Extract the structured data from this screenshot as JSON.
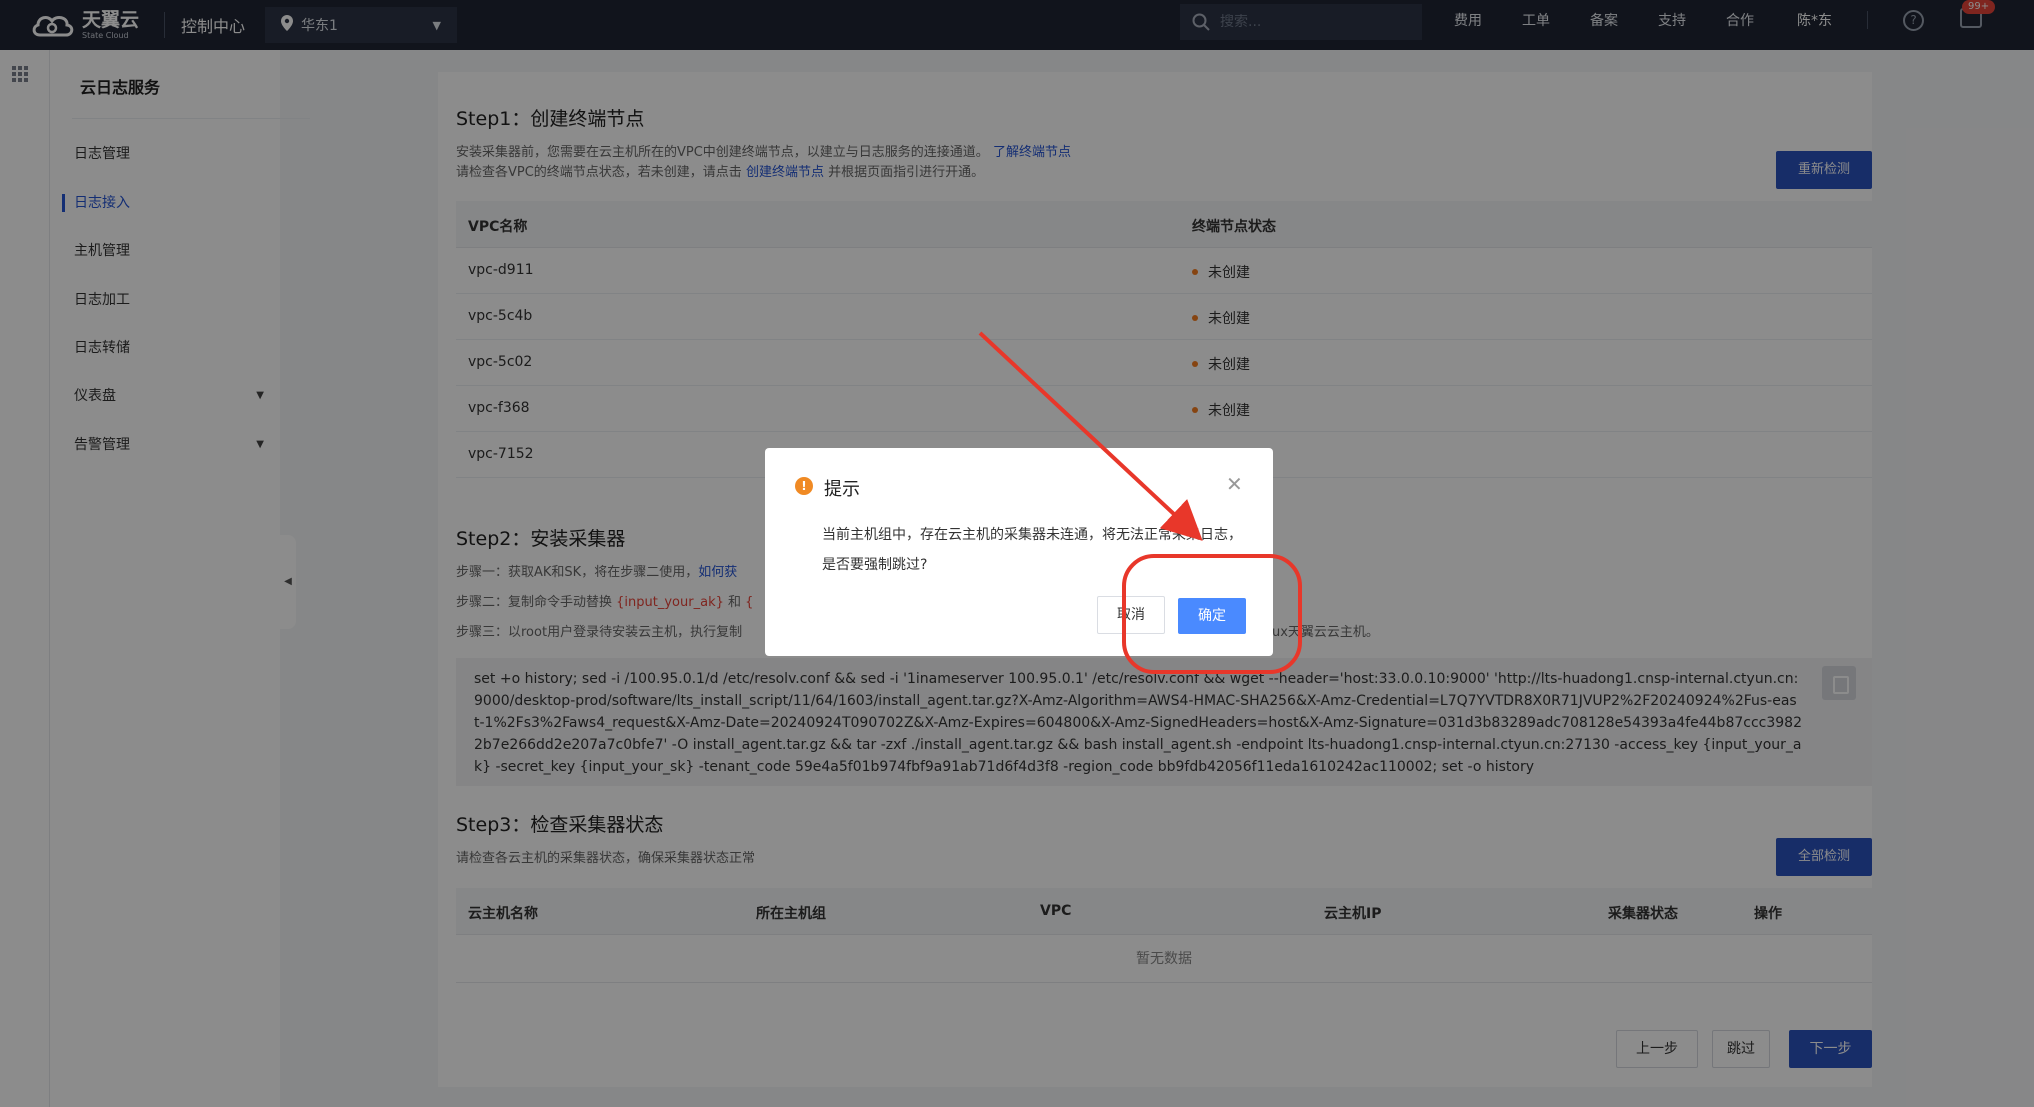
{
  "topbar": {
    "logo_cn": "天翼云",
    "logo_en": "State Cloud",
    "console": "控制中心",
    "region": "华东1",
    "search_placeholder": "搜索...",
    "nav": [
      "费用",
      "工单",
      "备案",
      "支持",
      "合作"
    ],
    "user": "陈*东",
    "badge": "99+"
  },
  "sidebar": {
    "title": "云日志服务",
    "items": [
      {
        "label": "日志管理"
      },
      {
        "label": "日志接入"
      },
      {
        "label": "主机管理"
      },
      {
        "label": "日志加工"
      },
      {
        "label": "日志转储"
      },
      {
        "label": "仪表盘"
      },
      {
        "label": "告警管理"
      }
    ]
  },
  "step1": {
    "title": "Step1：创建终端节点",
    "desc1": "安装采集器前，您需要在云主机所在的VPC中创建终端节点，以建立与日志服务的连接通道。",
    "desc1_link": "了解终端节点",
    "desc2_a": "请检查各VPC的终端节点状态，若未创建，请点击",
    "desc2_link": "创建终端节点",
    "desc2_b": "并根据页面指引进行开通。",
    "recheck": "重新检测",
    "col_vpc": "VPC名称",
    "col_status": "终端节点状态",
    "rows": [
      {
        "name": "vpc-d911",
        "status": "未创建"
      },
      {
        "name": "vpc-5c4b",
        "status": "未创建"
      },
      {
        "name": "vpc-5c02",
        "status": "未创建"
      },
      {
        "name": "vpc-f368",
        "status": "未创建"
      },
      {
        "name": "vpc-7152",
        "status": ""
      }
    ]
  },
  "step2": {
    "title": "Step2：安装采集器",
    "line1": "步骤一：获取AK和SK，将在步骤二使用，",
    "line1_link": "如何获",
    "line2_a": "步骤二：复制命令手动替换",
    "line2_red": "{input_your_ak}",
    "line2_b": "和",
    "line2_red2": "{",
    "line3": "步骤三：以root用户登录待安装云主机，执行复制",
    "line3_tail": "ux天翼云云主机。",
    "command": "set +o history; sed -i /100.95.0.1/d /etc/resolv.conf && sed -i '1inameserver 100.95.0.1' /etc/resolv.conf && wget --header='host:33.0.0.10:9000' 'http://lts-huadong1.cnsp-internal.ctyun.cn:9000/desktop-prod/software/lts_install_script/11/64/1603/install_agent.tar.gz?X-Amz-Algorithm=AWS4-HMAC-SHA256&X-Amz-Credential=L7Q7YVTDR8X0R71JVUP2%2F20240924%2Fus-east-1%2Fs3%2Faws4_request&X-Amz-Date=20240924T090702Z&X-Amz-Expires=604800&X-Amz-SignedHeaders=host&X-Amz-Signature=031d3b83289adc708128e54393a4fe44b87ccc39822b7e266dd2e207a7c0bfe7' -O install_agent.tar.gz && tar -zxf ./install_agent.tar.gz && bash install_agent.sh -endpoint lts-huadong1.cnsp-internal.ctyun.cn:27130 -access_key {input_your_ak} -secret_key {input_your_sk} -tenant_code 59e4a5f01b974fbf9a91ab71d6f4d3f8 -region_code bb9fdb42056f11eda1610242ac110002; set -o history"
  },
  "step3": {
    "title": "Step3：检查采集器状态",
    "desc": "请检查各云主机的采集器状态，确保采集器状态正常",
    "check_all": "全部检测",
    "cols": [
      "云主机名称",
      "所在主机组",
      "VPC",
      "云主机IP",
      "采集器状态",
      "操作"
    ],
    "empty": "暂无数据"
  },
  "footer": {
    "prev": "上一步",
    "skip": "跳过",
    "next": "下一步"
  },
  "modal": {
    "title": "提示",
    "body": "当前主机组中，存在云主机的采集器未连通，将无法正常采集日志，是否要强制跳过?",
    "cancel": "取消",
    "ok": "确定"
  },
  "colors": {
    "primary": "#2a52be",
    "confirm": "#4a8aff",
    "warning": "#f08a24",
    "annotation": "#e8372a"
  }
}
